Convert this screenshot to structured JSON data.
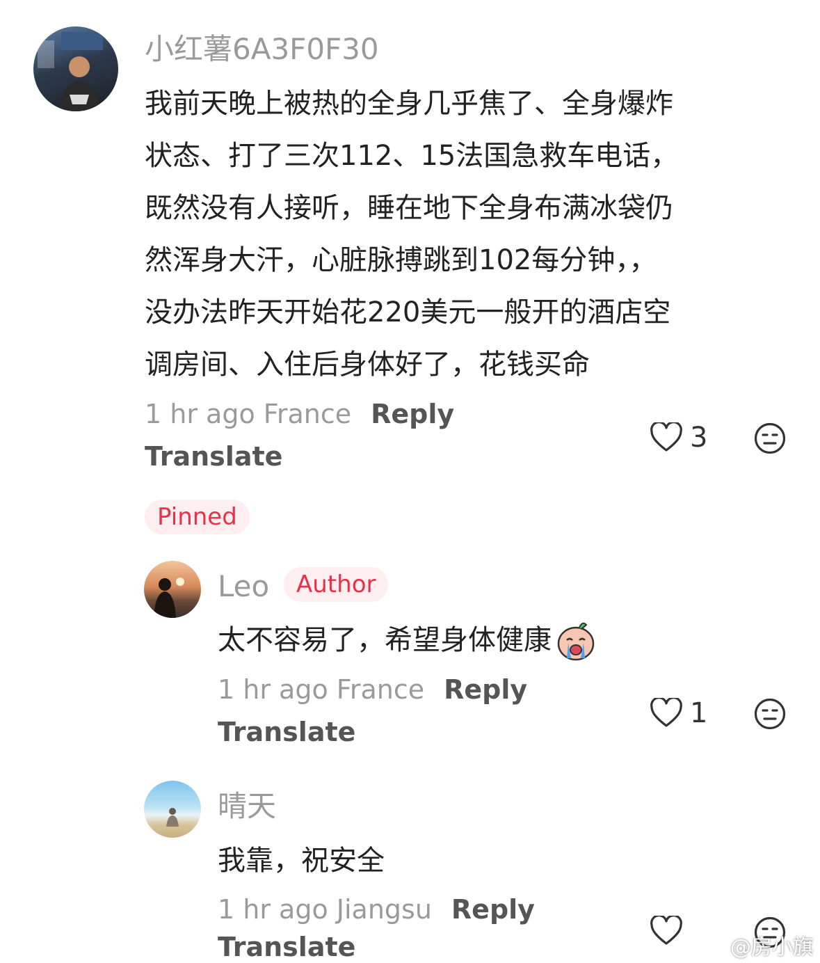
{
  "comment": {
    "username": "小红薯6A3F0F30",
    "lines": [
      "我前天晚上被热的全身几乎焦了、全身爆炸",
      "状态、打了三次112、15法国急救车电话，",
      "既然没有人接听，睡在地下全身布满冰袋仍",
      "然浑身大汗，心脏脉搏跳到102每分钟，，",
      "没办法昨天开始花220美元一般开的酒店空",
      "调房间、入住后身体好了，花钱买命"
    ],
    "meta": "1 hr ago France",
    "reply_label": "Reply",
    "translate_label": "Translate",
    "likes": "3",
    "pinned_label": "Pinned"
  },
  "replies": [
    {
      "username": "Leo",
      "badge": "Author",
      "text": "太不容易了，希望身体健康",
      "meta": "1 hr ago France",
      "reply_label": "Reply",
      "translate_label": "Translate",
      "likes": "1"
    },
    {
      "username": "晴天",
      "text": "我靠，祝安全",
      "meta": "1 hr ago Jiangsu",
      "reply_label": "Reply",
      "translate_label": "Translate",
      "likes": ""
    }
  ],
  "watermark": "@房小旗",
  "icons": {
    "like": "heart-outline-icon",
    "dislike": "neutral-face-icon",
    "emoji": "crying-emoji-icon",
    "watermark_logo": "weibo-logo-icon"
  },
  "colors": {
    "tag_text": "#e8304a",
    "tag_bg": "#fdeef0",
    "muted": "#9a9a9a",
    "text": "#222222"
  }
}
